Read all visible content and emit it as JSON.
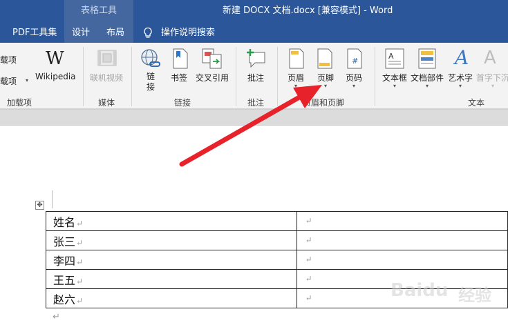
{
  "titlebar": {
    "context_group": "表格工具",
    "document_title": "新建 DOCX 文档.docx [兼容模式]  -  Word"
  },
  "tabs": {
    "pdf": "PDF工具集",
    "design": "设计",
    "layout": "布局",
    "search": "操作说明搜索"
  },
  "ribbon": {
    "addins": {
      "item1": "载项",
      "item2": "载项",
      "wikipedia": "Wikipedia",
      "group": "加载项"
    },
    "media": {
      "online_video": "联机视频",
      "group": "媒体"
    },
    "links": {
      "link": "链接",
      "bookmark": "书签",
      "cross_ref": "交叉引用",
      "group": "链接"
    },
    "comments": {
      "comment": "批注",
      "group": "批注"
    },
    "header_footer": {
      "header": "页眉",
      "footer": "页脚",
      "page_number": "页码",
      "group": "页眉和页脚"
    },
    "text": {
      "textbox": "文本框",
      "quick_parts": "文档部件",
      "wordart": "艺术字",
      "drop_cap": "首字下沉",
      "group": "文本"
    }
  },
  "document": {
    "table_rows": [
      {
        "name": "姓名"
      },
      {
        "name": "张三"
      },
      {
        "name": "李四"
      },
      {
        "name": "王五"
      },
      {
        "name": "赵六"
      }
    ],
    "paragraph_mark": "↵"
  },
  "watermark": {
    "brand": "Baidu",
    "suffix": "经验"
  },
  "colors": {
    "titlebar": "#2b579a",
    "context_tab": "#44679f",
    "ribbon_bg": "#f3f3f3",
    "arrow": "#e8222a"
  }
}
